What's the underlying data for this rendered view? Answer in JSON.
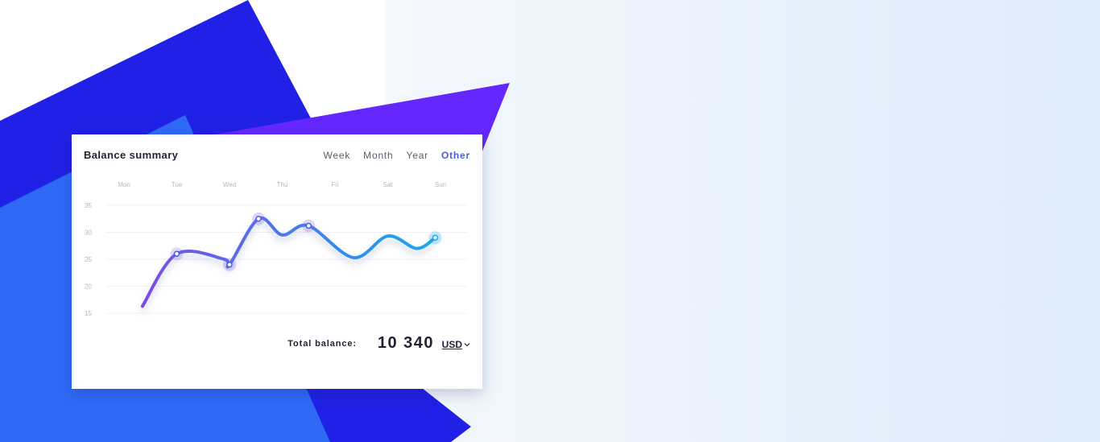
{
  "card": {
    "title": "Balance summary",
    "tabs": [
      "Week",
      "Month",
      "Year",
      "Other"
    ],
    "active_tab": "Other",
    "total_label": "Total balance:",
    "total_value": "10 340",
    "currency": "USD"
  },
  "colors": {
    "accent": "#4a5ce6",
    "line_start": "#7b4ce8",
    "line_end": "#17a9ee",
    "shape_dark_blue": "#2120e6",
    "shape_blue": "#2f6af7",
    "shape_purple": "#6527ff",
    "panel_bg": "#e9f2fc"
  },
  "chart_data": {
    "type": "line",
    "categories": [
      "Mon",
      "Tue",
      "Wed",
      "Thu",
      "Fri",
      "Sat",
      "Sun"
    ],
    "yticks": [
      35,
      30,
      25,
      20,
      15
    ],
    "ylim": [
      15,
      35
    ],
    "grid": true,
    "smooth": true,
    "series": [
      {
        "x": [
          0.35,
          1,
          1.9,
          2,
          2.55,
          3,
          3.5,
          4.35,
          5,
          5.55,
          5.9
        ],
        "values": [
          16.3,
          26,
          25,
          24,
          32.5,
          29.5,
          31.2,
          25.3,
          29.3,
          27,
          29
        ],
        "markers": [
          1,
          3,
          4,
          6,
          10
        ]
      }
    ]
  }
}
